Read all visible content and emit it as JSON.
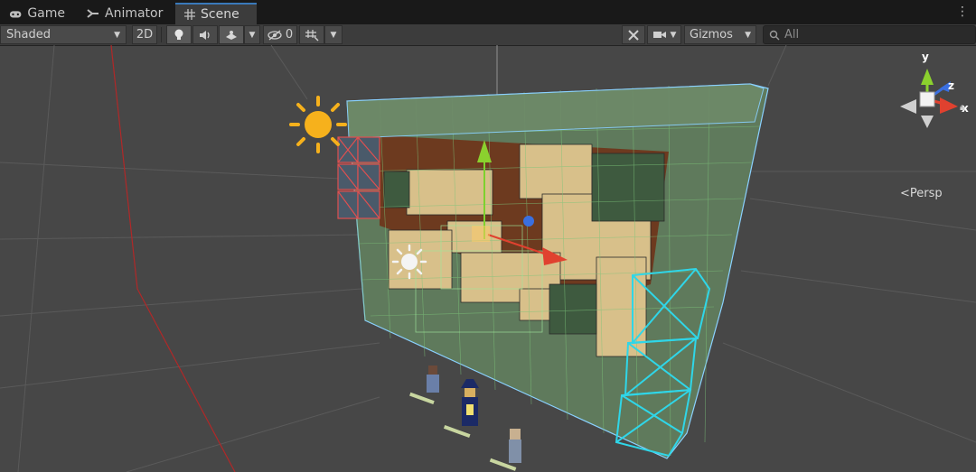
{
  "tabs": [
    {
      "label": "Game",
      "icon": "gamepad-icon"
    },
    {
      "label": "Animator",
      "icon": "animator-icon"
    },
    {
      "label": "Scene",
      "icon": "grid-icon"
    }
  ],
  "toolbar": {
    "draw_mode": "Shaded",
    "mode_2d": "2D",
    "hidden_count": "0",
    "gizmos": "Gizmos",
    "search_placeholder": "All"
  },
  "scene_gizmo": {
    "projection": "Persp",
    "axes": {
      "y": "y",
      "z": "z",
      "x": "x"
    }
  },
  "colors": {
    "axis_x": "#e0412f",
    "axis_y": "#8bd12e",
    "axis_z": "#3a6fe0",
    "tab_accent": "#3a79bb",
    "light_gizmo": "#f6b11c"
  }
}
